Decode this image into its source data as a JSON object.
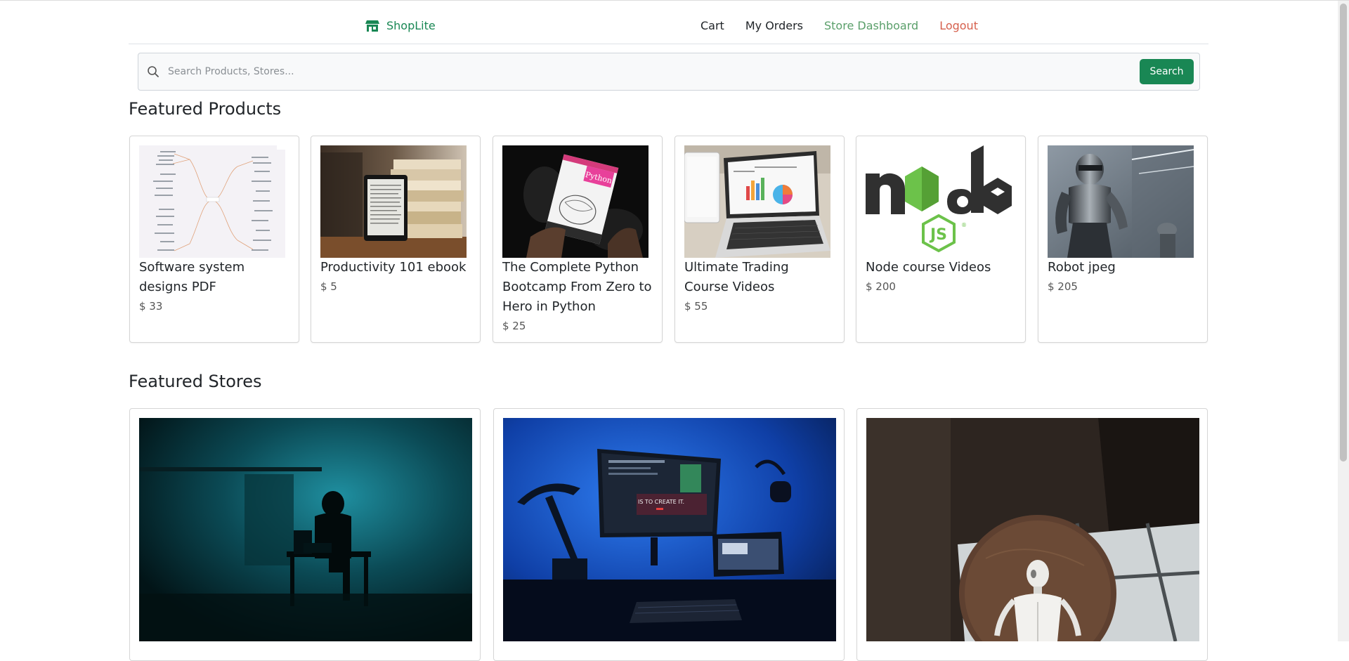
{
  "navbar": {
    "brand": "ShopLite",
    "links": [
      {
        "label": "Cart",
        "color": "#212529"
      },
      {
        "label": "My Orders",
        "color": "#212529"
      },
      {
        "label": "Store Dashboard",
        "color": "#5a9f6a"
      },
      {
        "label": "Logout",
        "color": "#d6604d"
      }
    ]
  },
  "search": {
    "placeholder": "Search Products, Stores...",
    "value": "",
    "button_label": "Search"
  },
  "sections": {
    "featured_products": "Featured Products",
    "featured_stores": "Featured Stores"
  },
  "products": [
    {
      "name": "Software system designs PDF",
      "price": "$ 33",
      "image": "mind-map-image"
    },
    {
      "name": "Productivity 101 ebook",
      "price": "$ 5",
      "image": "ebook-books-image"
    },
    {
      "name": "The Complete Python Bootcamp From Zero to Hero in Python",
      "price": "$ 25",
      "image": "python-book-image"
    },
    {
      "name": "Ultimate Trading Course Videos",
      "price": "$ 55",
      "image": "laptop-charts-image"
    },
    {
      "name": "Node course Videos",
      "price": "$ 200",
      "image": "nodejs-logo-image"
    },
    {
      "name": "Robot jpeg",
      "price": "$ 205",
      "image": "robot-image"
    }
  ],
  "stores": [
    {
      "image": "hacker-dark-room-image"
    },
    {
      "image": "blue-desk-setup-image"
    },
    {
      "image": "android-figure-image"
    }
  ],
  "colors": {
    "brand": "#198754",
    "link_dashboard": "#5a9f6a",
    "link_logout": "#d6604d"
  }
}
